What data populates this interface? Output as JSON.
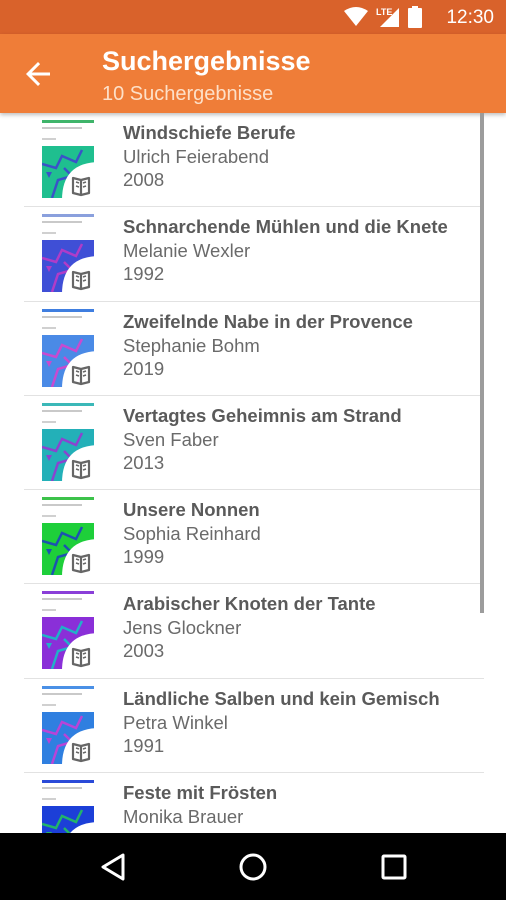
{
  "status": {
    "time": "12:30",
    "network": "LTE"
  },
  "appbar": {
    "title": "Suchergebnisse",
    "subtitle": "10 Suchergebnisse"
  },
  "colors": {
    "primary": "#ef7d38",
    "primary_dark": "#d9622b"
  },
  "results": [
    {
      "title": "Windschiefe Berufe",
      "author": "Ulrich Feierabend",
      "year": "2008",
      "cover": {
        "bg": "#1fbf8f",
        "line": "#3a52c8",
        "bar": "#3fb46a"
      }
    },
    {
      "title": "Schnarchende Mühlen und die Knete",
      "author": "Melanie Wexler",
      "year": "1992",
      "cover": {
        "bg": "#3f4fd6",
        "line": "#b03cc8",
        "bar": "#8aa0dd"
      }
    },
    {
      "title": "Zweifelnde Nabe in der Provence",
      "author": "Stephanie Bohm",
      "year": "2019",
      "cover": {
        "bg": "#4a8ae6",
        "line": "#c84ad0",
        "bar": "#3f7ee0"
      }
    },
    {
      "title": "Vertagtes Geheimnis am Strand",
      "author": "Sven Faber",
      "year": "2013",
      "cover": {
        "bg": "#23b0b8",
        "line": "#8a44d0",
        "bar": "#3bb8b8"
      }
    },
    {
      "title": "Unsere Nonnen",
      "author": "Sophia Reinhard",
      "year": "1999",
      "cover": {
        "bg": "#1ecf3a",
        "line": "#1c52b0",
        "bar": "#3cc24a"
      }
    },
    {
      "title": "Arabischer Knoten der Tante",
      "author": "Jens Glockner",
      "year": "2003",
      "cover": {
        "bg": "#8a2fd8",
        "line": "#22b0c8",
        "bar": "#8a3fd8"
      }
    },
    {
      "title": "Ländliche Salben und kein Gemisch",
      "author": "Petra Winkel",
      "year": "1991",
      "cover": {
        "bg": "#2f7fe0",
        "line": "#b844d8",
        "bar": "#4a90e6"
      }
    },
    {
      "title": "Feste mit Frösten",
      "author": "Monika Brauer",
      "year": "",
      "cover": {
        "bg": "#1c3fd8",
        "line": "#22b46a",
        "bar": "#2a4ad8"
      }
    }
  ],
  "nav": {
    "back_icon": "triangle-back-icon",
    "home_icon": "circle-home-icon",
    "recents_icon": "square-recents-icon"
  }
}
